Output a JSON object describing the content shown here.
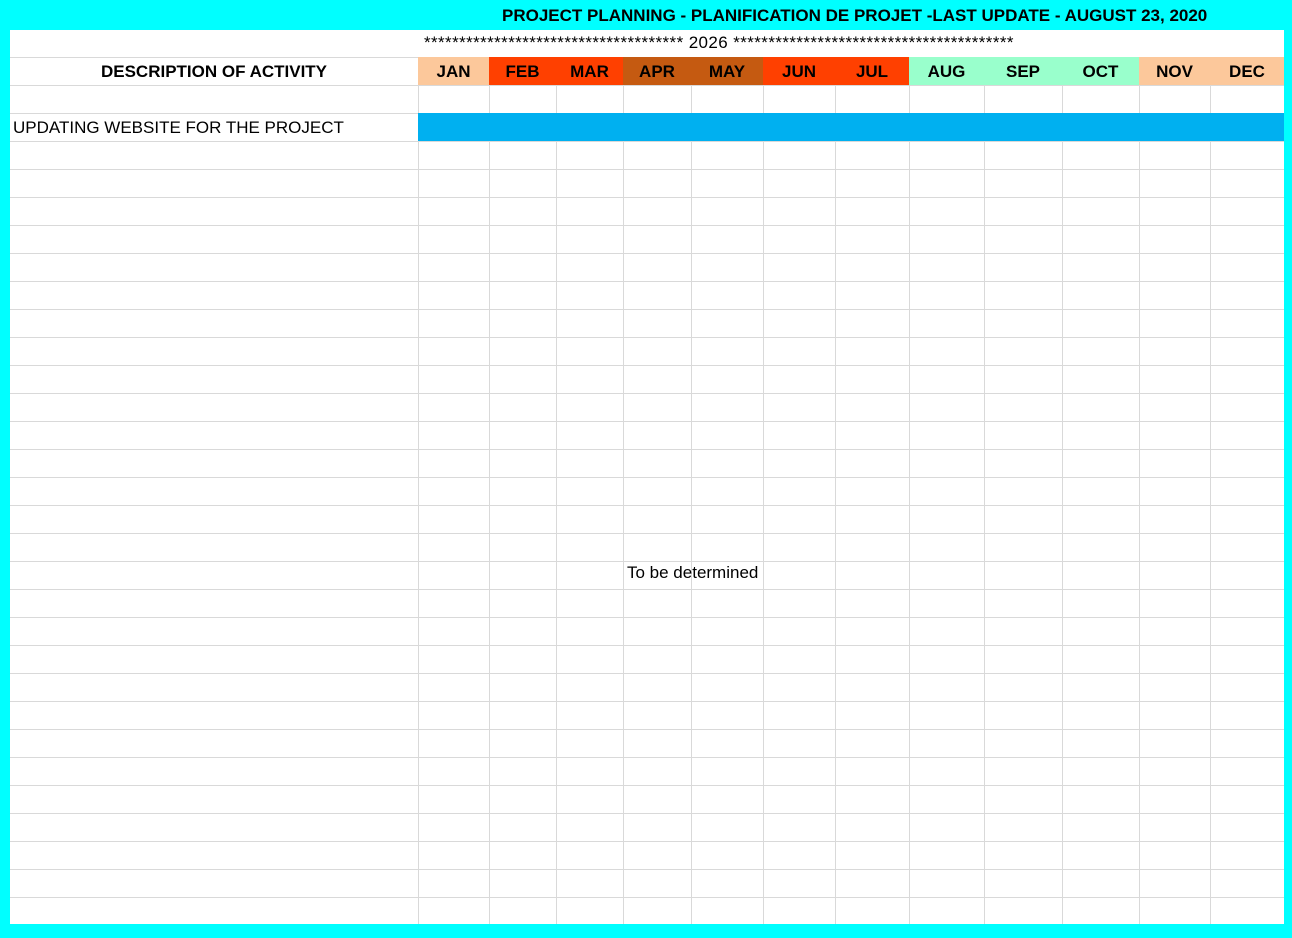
{
  "title": "PROJECT PLANNING - PLANIFICATION DE PROJET -LAST UPDATE - AUGUST 23, 2020",
  "year_line": "************************************* 2026 ****************************************",
  "description_header": "DESCRIPTION OF ACTIVITY",
  "months": [
    {
      "label": "JAN",
      "color": "#fcc89b"
    },
    {
      "label": "FEB",
      "color": "#ff4000"
    },
    {
      "label": "MAR",
      "color": "#ff4000"
    },
    {
      "label": "APR",
      "color": "#c55a11"
    },
    {
      "label": "MAY",
      "color": "#c55a11"
    },
    {
      "label": "JUN",
      "color": "#ff4000"
    },
    {
      "label": "JUL",
      "color": "#ff4000"
    },
    {
      "label": "AUG",
      "color": "#99ffcc"
    },
    {
      "label": "SEP",
      "color": "#99ffcc"
    },
    {
      "label": "OCT",
      "color": "#99ffcc"
    },
    {
      "label": "NOV",
      "color": "#fcc89b"
    },
    {
      "label": "DEC",
      "color": "#fcc89b"
    }
  ],
  "activities": [
    {
      "label": "UPDATING WEBSITE FOR THE PROJECT",
      "bar_color": "#00b0f0",
      "start_month": "JAN",
      "end_month": "DEC"
    }
  ],
  "note": "To be determined",
  "colors": {
    "frame": "#00ffff",
    "gridline": "#d9d9d9"
  }
}
